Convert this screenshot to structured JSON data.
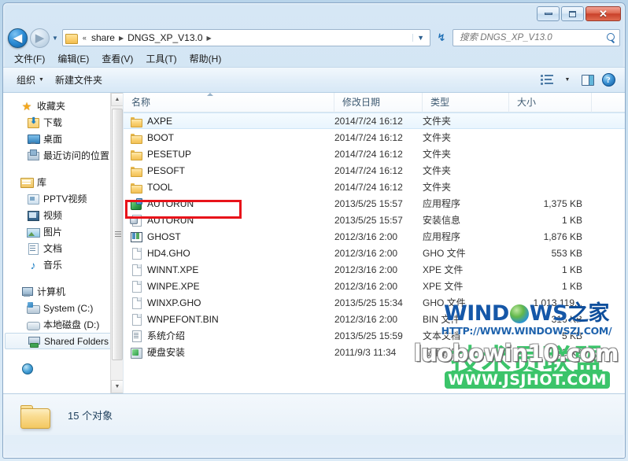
{
  "window": {
    "controls": {
      "minimize": "—",
      "maximize": "□",
      "close": "✕"
    }
  },
  "address": {
    "back_arrow": "◀",
    "forward_arrow": "▶",
    "recent_caret": "▼",
    "overflow": "«",
    "crumbs": [
      "share",
      "DNGS_XP_V13.0"
    ],
    "chevron": "▶",
    "dropdown_caret": "▼",
    "refresh_glyph": "↯"
  },
  "search": {
    "placeholder": "搜索 DNGS_XP_V13.0",
    "value": ""
  },
  "menubar": {
    "items": [
      "文件(F)",
      "编辑(E)",
      "查看(V)",
      "工具(T)",
      "帮助(H)"
    ]
  },
  "toolbar": {
    "organize_label": "组织",
    "organize_caret": "▼",
    "new_folder_label": "新建文件夹",
    "view_caret": "▼",
    "help_glyph": "?"
  },
  "sidebar": {
    "groups": [
      {
        "header": {
          "label": "收藏夹",
          "icon": "star-icon"
        },
        "items": [
          {
            "label": "下载",
            "icon": "download-folder-icon"
          },
          {
            "label": "桌面",
            "icon": "desktop-icon"
          },
          {
            "label": "最近访问的位置",
            "icon": "recent-places-icon"
          }
        ]
      },
      {
        "header": {
          "label": "库",
          "icon": "library-icon"
        },
        "items": [
          {
            "label": "PPTV视频",
            "icon": "pptv-video-icon"
          },
          {
            "label": "视频",
            "icon": "video-icon"
          },
          {
            "label": "图片",
            "icon": "pictures-icon"
          },
          {
            "label": "文档",
            "icon": "documents-icon"
          },
          {
            "label": "音乐",
            "icon": "music-icon"
          }
        ]
      },
      {
        "header": {
          "label": "计算机",
          "icon": "computer-icon"
        },
        "items": [
          {
            "label": "System (C:)",
            "icon": "system-drive-icon"
          },
          {
            "label": "本地磁盘 (D:)",
            "icon": "local-drive-icon"
          },
          {
            "label": "Shared Folders",
            "icon": "shared-folder-icon",
            "selected": true
          }
        ]
      }
    ],
    "scroll_up": "▲",
    "scroll_down": "▼"
  },
  "filelist": {
    "columns": [
      "名称",
      "修改日期",
      "类型",
      "大小"
    ],
    "rows": [
      {
        "name": "AXPE",
        "date": "2014/7/24 16:12",
        "type": "文件夹",
        "size": "",
        "icon": "folder-icon",
        "hover": true
      },
      {
        "name": "BOOT",
        "date": "2014/7/24 16:12",
        "type": "文件夹",
        "size": "",
        "icon": "folder-icon"
      },
      {
        "name": "PESETUP",
        "date": "2014/7/24 16:12",
        "type": "文件夹",
        "size": "",
        "icon": "folder-icon"
      },
      {
        "name": "PESOFT",
        "date": "2014/7/24 16:12",
        "type": "文件夹",
        "size": "",
        "icon": "folder-icon"
      },
      {
        "name": "TOOL",
        "date": "2014/7/24 16:12",
        "type": "文件夹",
        "size": "",
        "icon": "folder-icon"
      },
      {
        "name": "AUTORUN",
        "date": "2013/5/25 15:57",
        "type": "应用程序",
        "size": "1,375 KB",
        "icon": "application-icon"
      },
      {
        "name": "AUTORUN",
        "date": "2013/5/25 15:57",
        "type": "安装信息",
        "size": "1 KB",
        "icon": "setup-information-icon"
      },
      {
        "name": "GHOST",
        "date": "2012/3/16 2:00",
        "type": "应用程序",
        "size": "1,876 KB",
        "icon": "ghost-application-icon"
      },
      {
        "name": "HD4.GHO",
        "date": "2012/3/16 2:00",
        "type": "GHO 文件",
        "size": "553 KB",
        "icon": "file-icon"
      },
      {
        "name": "WINNT.XPE",
        "date": "2012/3/16 2:00",
        "type": "XPE 文件",
        "size": "1 KB",
        "icon": "file-icon"
      },
      {
        "name": "WINPE.XPE",
        "date": "2012/3/16 2:00",
        "type": "XPE 文件",
        "size": "1 KB",
        "icon": "file-icon"
      },
      {
        "name": "WINXP.GHO",
        "date": "2013/5/25 15:34",
        "type": "GHO 文件",
        "size": "1,013,119...",
        "icon": "file-icon"
      },
      {
        "name": "WNPEFONT.BIN",
        "date": "2012/3/16 2:00",
        "type": "BIN 文件",
        "size": "316 KB",
        "icon": "file-icon"
      },
      {
        "name": "系统介绍",
        "date": "2013/5/25 15:59",
        "type": "文本文档",
        "size": "5 KB",
        "icon": "text-document-icon"
      },
      {
        "name": "硬盘安装",
        "date": "2011/9/3 11:34",
        "type": "应用程序",
        "size": "5,552 KB",
        "icon": "installer-icon"
      }
    ]
  },
  "statusbar": {
    "text": "15 个对象"
  },
  "watermarks": {
    "windowszj_pre": "WIND",
    "windowszj_post": "WS",
    "windowszj_cn": "之家",
    "windowszj_url": "HTTP://WWW.WINDOWSZJ.COM/",
    "jsjhot_main": "技术员联盟",
    "jsjhot_url": "WWW.JSJHOT.COM",
    "luobowin": "luobowin10.com"
  },
  "colors": {
    "accent": "#1557a8",
    "annotation_red": "#e8131a",
    "jsjhot_green": "#3bc46a",
    "close_red": "#c9402a"
  }
}
